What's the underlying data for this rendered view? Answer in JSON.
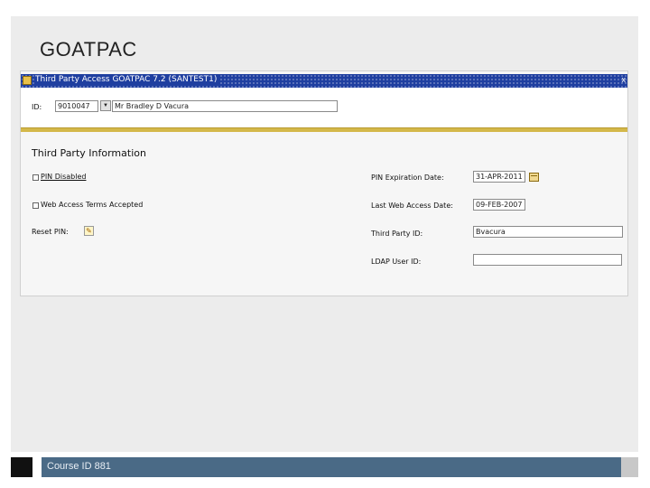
{
  "slide": {
    "title": "GOATPAC",
    "footer_text": "Course ID 881"
  },
  "window": {
    "title": "Third Party Access GOATPAC 7.2 (SANTEST1)",
    "close_glyph": "x"
  },
  "key_block": {
    "id_label": "ID:",
    "id_value": "9010047",
    "name_value": "Mr Bradley D Vacura",
    "dropdown_glyph": "▼"
  },
  "section": {
    "title": "Third Party Information",
    "pin_disabled_label": "PIN Disabled",
    "web_terms_label": "Web Access Terms Accepted",
    "reset_pin_label": "Reset PIN:",
    "pin_exp_label": "PIN Expiration Date:",
    "pin_exp_value": "31-APR-2011",
    "last_web_label": "Last Web Access Date:",
    "last_web_value": "09-FEB-2007",
    "third_party_id_label": "Third Party ID:",
    "third_party_id_value": "Bvacura",
    "ldap_label": "LDAP User ID:",
    "ldap_value": ""
  },
  "icons": {
    "window_icon": "form-icon",
    "calendar_icon": "calendar-icon",
    "reset_icon": "key-icon"
  }
}
